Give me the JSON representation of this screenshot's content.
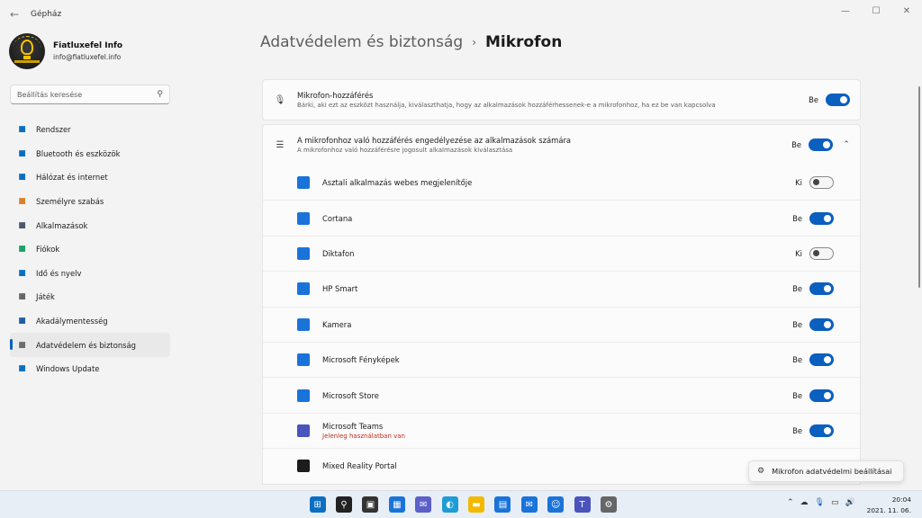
{
  "window": {
    "title": "Gépház",
    "back_icon": "back-arrow-icon",
    "controls": [
      "minimize",
      "maximize",
      "close"
    ]
  },
  "profile": {
    "name": "Fiatluxefel Info",
    "email": "info@fiatluxefel.info"
  },
  "search": {
    "placeholder": "Beállítás keresése"
  },
  "sidebar": {
    "items": [
      {
        "label": "Rendszer",
        "icon": "monitor-icon",
        "color": "#0a6fc2"
      },
      {
        "label": "Bluetooth és eszközök",
        "icon": "bluetooth-icon",
        "color": "#0a6fc2"
      },
      {
        "label": "Hálózat és internet",
        "icon": "wifi-icon",
        "color": "#0a6fc2"
      },
      {
        "label": "Személyre szabás",
        "icon": "brush-icon",
        "color": "#d9822b"
      },
      {
        "label": "Alkalmazások",
        "icon": "apps-icon",
        "color": "#4a5a6a"
      },
      {
        "label": "Fiókok",
        "icon": "person-icon",
        "color": "#1aa36b"
      },
      {
        "label": "Idő és nyelv",
        "icon": "globe-clock-icon",
        "color": "#0a6fc2"
      },
      {
        "label": "Játék",
        "icon": "gamepad-icon",
        "color": "#666666"
      },
      {
        "label": "Akadálymentesség",
        "icon": "accessibility-icon",
        "color": "#1f5fa8"
      },
      {
        "label": "Adatvédelem és biztonság",
        "icon": "shield-icon",
        "color": "#6b6b6b",
        "active": true
      },
      {
        "label": "Windows Update",
        "icon": "update-icon",
        "color": "#0a6fc2"
      }
    ]
  },
  "breadcrumb": {
    "parent": "Adatvédelem és biztonság",
    "separator": "›",
    "current": "Mikrofon"
  },
  "mic_access": {
    "title": "Mikrofon-hozzáférés",
    "desc": "Bárki, aki ezt az eszközt használja, kiválaszthatja, hogy az alkalmazások hozzáférhessenek-e a mikrofonhoz, ha ez be van kapcsolva",
    "state": "Be",
    "on": true
  },
  "apps_access": {
    "title": "A mikrofonhoz való hozzáférés engedélyezése az alkalmazások számára",
    "desc": "A mikrofonhoz való hozzáférésre jogosult alkalmazások kiválasztása",
    "state": "Be",
    "on": true,
    "expanded": true
  },
  "apps": [
    {
      "name": "Asztali alkalmazás webes megjelenítője",
      "state": "Ki",
      "on": false,
      "icon": "webview-icon",
      "color": "#1a73d9"
    },
    {
      "name": "Cortana",
      "state": "Be",
      "on": true,
      "icon": "cortana-icon",
      "color": "#1a73d9"
    },
    {
      "name": "Diktafon",
      "state": "Ki",
      "on": false,
      "icon": "recorder-icon",
      "color": "#1a73d9"
    },
    {
      "name": "HP Smart",
      "state": "Be",
      "on": true,
      "icon": "hp-smart-icon",
      "color": "#1a73d9"
    },
    {
      "name": "Kamera",
      "state": "Be",
      "on": true,
      "icon": "camera-icon",
      "color": "#1a73d9"
    },
    {
      "name": "Microsoft Fényképek",
      "state": "Be",
      "on": true,
      "icon": "photos-icon",
      "color": "#1a73d9"
    },
    {
      "name": "Microsoft Store",
      "state": "Be",
      "on": true,
      "icon": "store-icon",
      "color": "#1a73d9"
    },
    {
      "name": "Microsoft Teams",
      "state": "Be",
      "on": true,
      "icon": "teams-icon",
      "color": "#4b53bc",
      "note": "Jelenleg használatban van"
    },
    {
      "name": "Mixed Reality Portal",
      "state": "",
      "on": null,
      "icon": "mixed-reality-icon",
      "color": "#1c1c1c"
    }
  ],
  "toast": {
    "label": "Mikrofon adatvédelmi beállításai",
    "icon": "gear-icon"
  },
  "taskbar": {
    "apps": [
      {
        "name": "start-icon",
        "color": "#0a6fc2"
      },
      {
        "name": "search-icon",
        "color": "#222222"
      },
      {
        "name": "task-view-icon",
        "color": "#333333"
      },
      {
        "name": "widgets-icon",
        "color": "#1a73d9"
      },
      {
        "name": "chat-icon",
        "color": "#5b5fc7"
      },
      {
        "name": "edge-icon",
        "color": "#1f9bd6"
      },
      {
        "name": "file-explorer-icon",
        "color": "#f2b900"
      },
      {
        "name": "store-icon",
        "color": "#1a73d9"
      },
      {
        "name": "mail-icon",
        "color": "#1a73d9"
      },
      {
        "name": "people-icon",
        "color": "#1a73d9"
      },
      {
        "name": "teams-icon",
        "color": "#4b53bc"
      },
      {
        "name": "settings-icon",
        "color": "#666666"
      }
    ],
    "time": "20:04",
    "date": "2021. 11. 06."
  }
}
